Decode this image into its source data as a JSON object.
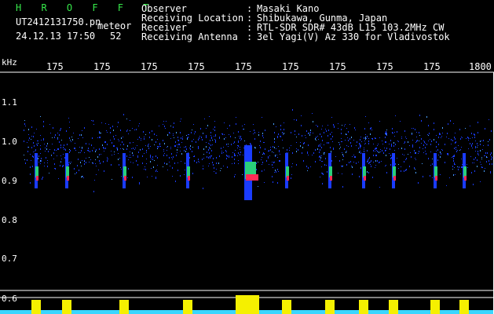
{
  "header": {
    "title": "H R O F F T",
    "filename": "UT2412131750.pn",
    "mode": "meteor",
    "datetime": "24.12.13 17:50",
    "count": "52",
    "fields": [
      {
        "key": "Observer",
        "value": "Masaki Kano"
      },
      {
        "key": "Receiving Location",
        "value": "Shibukawa, Gunma, Japan"
      },
      {
        "key": "Receiver",
        "value": "RTL-SDR SDR# 43dB L15 103.2MHz CW"
      },
      {
        "key": "Receiving Antenna",
        "value": "3el Yagi(V) Az 330 for Vladivostok"
      }
    ]
  },
  "axis": {
    "unit": "kHz",
    "time_ticks": [
      "175",
      "175",
      "175",
      "175",
      "175",
      "175",
      "175",
      "175",
      "175",
      "1800"
    ],
    "freq_ticks": [
      "1.1",
      "1.0",
      "0.9",
      "0.8",
      "0.7",
      "0.6"
    ]
  },
  "colors": {
    "background": "#000000",
    "noise": "#1a3cff",
    "echo_hot": "#ff2a55",
    "echo_warm": "#ffe000",
    "level_fill": "#f5f000",
    "level_base": "#3ad6ff"
  }
}
